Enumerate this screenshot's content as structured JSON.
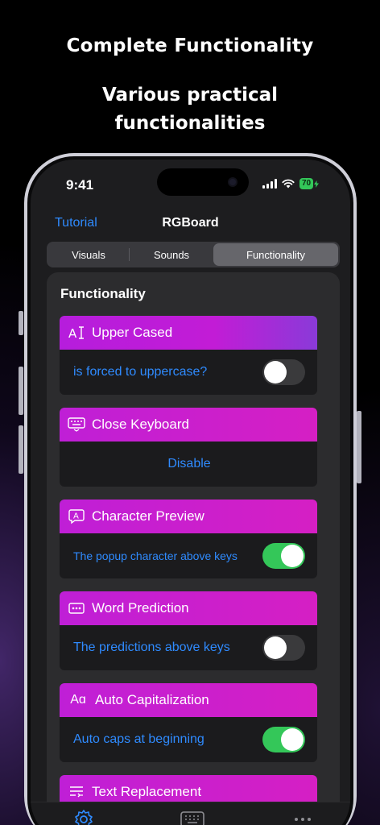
{
  "headline": "Complete  Functionality",
  "subheadline": "Various practical functionalities",
  "status": {
    "time": "9:41",
    "battery": "70"
  },
  "nav": {
    "back_label": "Tutorial",
    "title": "RGBoard"
  },
  "segments": [
    "Visuals",
    "Sounds",
    "Functionality"
  ],
  "selected_segment": "Functionality",
  "card_title": "Functionality",
  "features": [
    {
      "icon": "text-cursor-icon",
      "title": "Upper Cased",
      "label": "is forced to uppercase?",
      "control": "toggle",
      "on": false
    },
    {
      "icon": "keyboard-dismiss-icon",
      "title": "Close Keyboard",
      "label": "Disable",
      "control": "link"
    },
    {
      "icon": "character-bubble-icon",
      "title": "Character Preview",
      "label": "The popup character above keys",
      "control": "toggle",
      "on": true
    },
    {
      "icon": "ellipsis-rect-icon",
      "title": "Word Prediction",
      "label": "The predictions above keys",
      "control": "toggle",
      "on": false
    },
    {
      "icon": "text-format-icon",
      "title": "Auto Capitalization",
      "label": "Auto caps at beginning",
      "control": "toggle",
      "on": true
    },
    {
      "icon": "text-replace-icon",
      "title": "Text Replacement"
    }
  ],
  "icon_glyphs": {
    "text-format": "Aɑ"
  },
  "tabbar": [
    "gear-icon",
    "keyboard-icon",
    "more-icon"
  ],
  "colors": {
    "accent": "#2f8bff",
    "toggle_on": "#34c759",
    "header_gradient_start": "#b61ddc",
    "header_gradient_end": "#d51fc4"
  }
}
